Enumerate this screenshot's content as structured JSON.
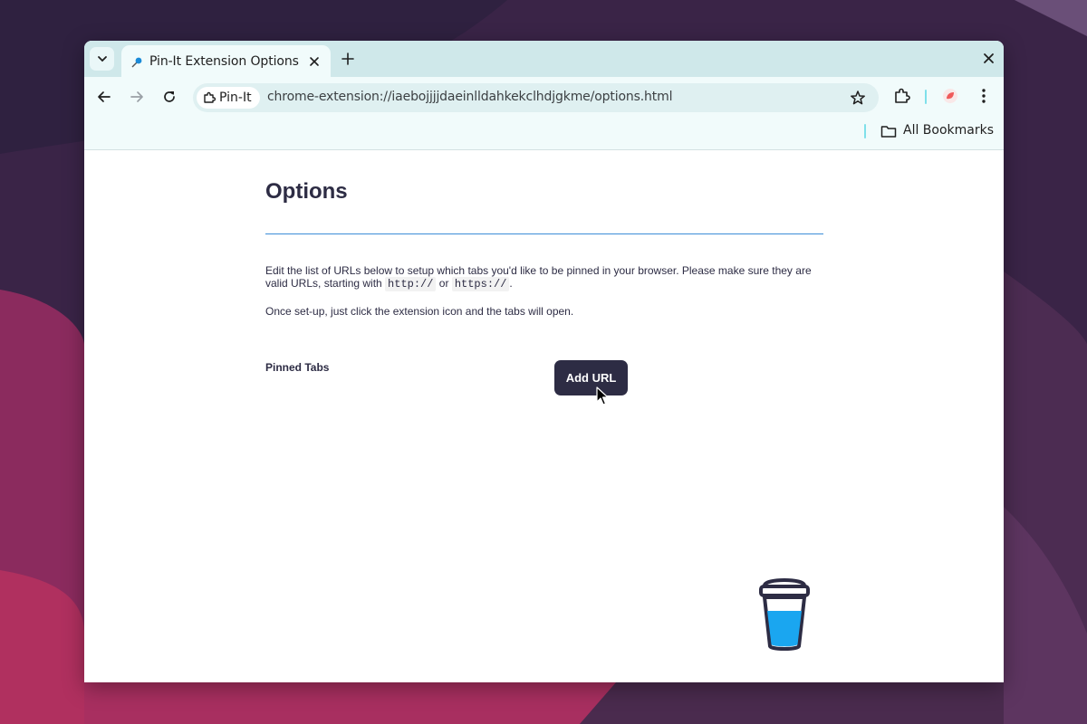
{
  "browser": {
    "tab": {
      "title": "Pin-It Extension Options",
      "favicon": "pin-icon"
    },
    "omnibox": {
      "chip_label": "Pin-It",
      "url": "chrome-extension://iaebojjjjdaeinlldahkekclhdjgkme/options.html"
    },
    "bookmarks": {
      "all_bookmarks_label": "All Bookmarks"
    },
    "colors": {
      "frame": "#cfe8ea",
      "toolbar": "#f1fbfb",
      "accent": "#7fe0ea"
    }
  },
  "page": {
    "title": "Options",
    "intro_before": "Edit the list of URLs below to setup which tabs you'd like to be pinned in your browser. Please make sure they are valid URLs, starting with ",
    "code_http": "http://",
    "intro_or": " or ",
    "code_https": "https://",
    "intro_after": ".",
    "intro2": "Once set-up, just click the extension icon and the tabs will open.",
    "pinned_tabs_label": "Pinned Tabs",
    "add_url_label": "Add URL",
    "colors": {
      "text": "#2d2c44",
      "rule": "#3c8dd8",
      "button": "#2d2c44",
      "cup_fill": "#1aa6f0"
    }
  }
}
